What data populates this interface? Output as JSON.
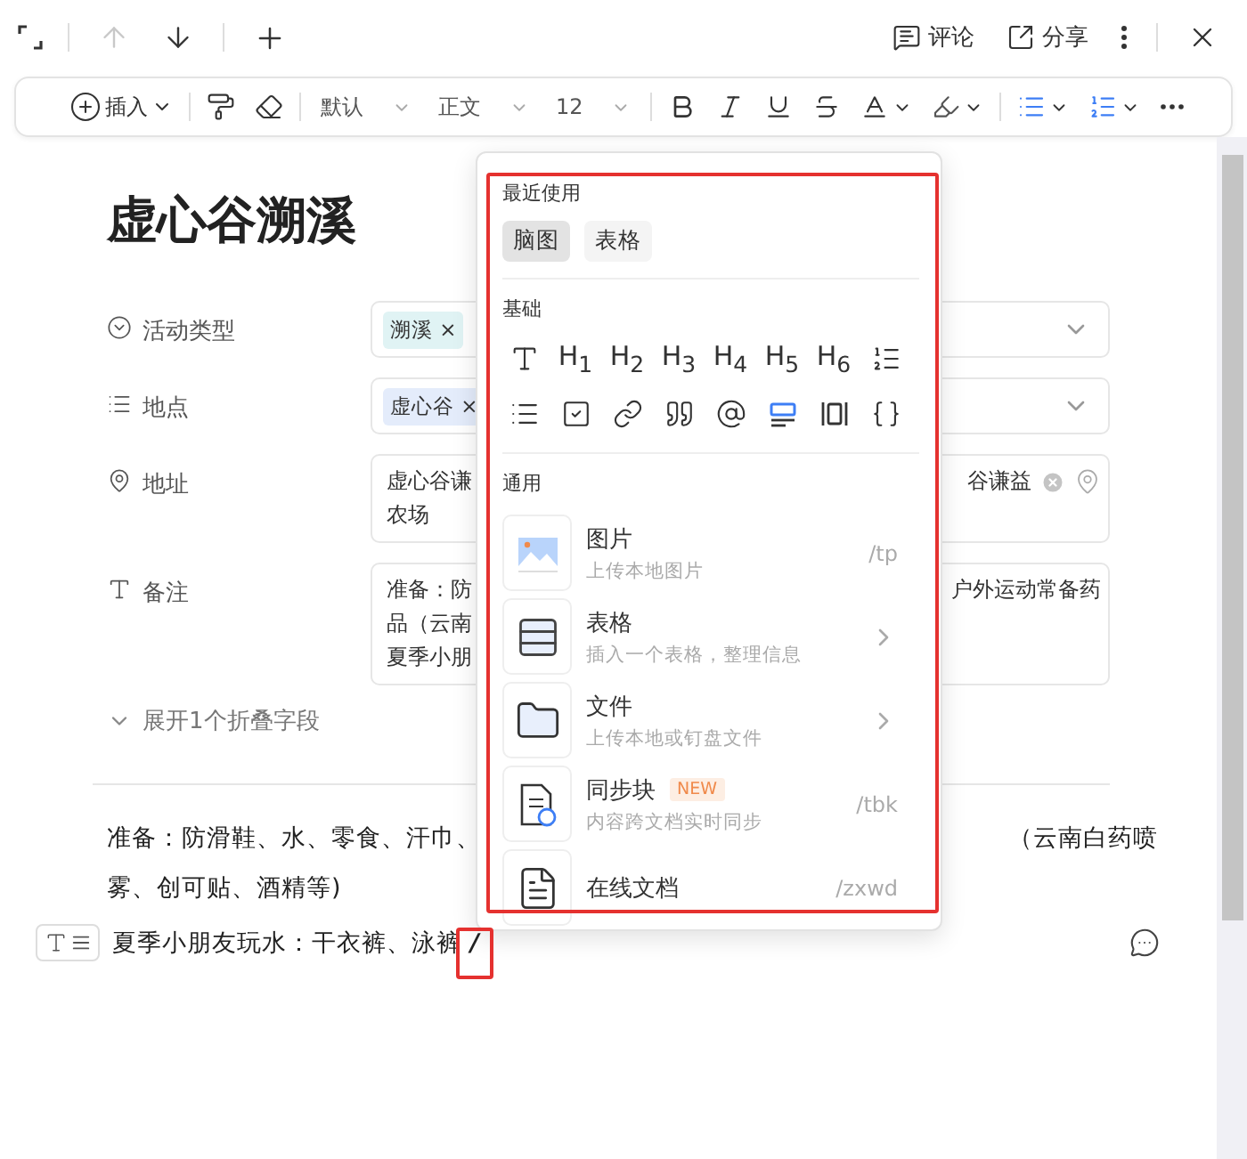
{
  "top_bar": {
    "nav": [
      {
        "kind": "up",
        "disabled": true
      },
      {
        "kind": "down",
        "disabled": false
      }
    ],
    "actions": [
      {
        "kind": "comment",
        "label": "评论"
      },
      {
        "kind": "share",
        "label": "分享"
      }
    ]
  },
  "toolbar": {
    "insert": "插入",
    "selects": [
      {
        "value": "默认"
      },
      {
        "value": "正文"
      },
      {
        "value": "12"
      }
    ]
  },
  "document": {
    "title": "虚心谷溯溪",
    "fields": [
      {
        "kind": "select",
        "label": "活动类型",
        "tags": [
          {
            "text": "溯溪",
            "remove": "×",
            "color": "#e0f3f4"
          }
        ]
      },
      {
        "kind": "select",
        "label": "地点",
        "tags": [
          {
            "text": "虚心谷",
            "remove": "×",
            "color": "#e4ecfb"
          }
        ]
      },
      {
        "kind": "address",
        "label": "地址",
        "left_lines": [
          "虚心谷谦",
          "农场"
        ],
        "right_text": "谷谦益"
      },
      {
        "kind": "note",
        "label": "备注",
        "left_lines": [
          "准备：防",
          "品（云南",
          "夏季小朋"
        ],
        "right_text": "户外运动常备药"
      }
    ],
    "expand": "展开1个折叠字段",
    "paragraph": [
      {
        "left": "准备：防滑鞋、水、零食、汗巾、",
        "right": "（云南白药喷"
      },
      {
        "left": "雾、创可贴、酒精等)"
      }
    ],
    "last_line": "夏季小朋友玩水：干衣裤、泳裤",
    "typed": "/"
  },
  "popup": {
    "sections": [
      {
        "kind": "recent",
        "title": "最近使用",
        "chips": [
          {
            "label": "脑图",
            "selected": true
          },
          {
            "label": "表格",
            "selected": false
          }
        ]
      },
      {
        "kind": "basic",
        "title": "基础",
        "items": [
          {
            "kind": "text"
          },
          {
            "kind": "heading",
            "label": "H$_{1}$"
          },
          {
            "kind": "heading",
            "label": "H$_{2}$"
          },
          {
            "kind": "heading",
            "label": "H$_{3}$"
          },
          {
            "kind": "heading",
            "label": "H$_{4}$"
          },
          {
            "kind": "heading",
            "label": "H$_{5}$"
          },
          {
            "kind": "heading",
            "label": "H$_{6}$"
          },
          {
            "kind": "ordered"
          },
          {
            "kind": "bullet"
          },
          {
            "kind": "todo"
          },
          {
            "kind": "link"
          },
          {
            "kind": "quote"
          },
          {
            "kind": "mention"
          },
          {
            "kind": "highlight"
          },
          {
            "kind": "columns"
          },
          {
            "kind": "code"
          }
        ]
      },
      {
        "kind": "general",
        "title": "通用",
        "items": [
          {
            "kind": "image",
            "title": "图片",
            "subtitle": "上传本地图片",
            "shortcut": "/tp",
            "submenu": false
          },
          {
            "kind": "table",
            "title": "表格",
            "subtitle": "插入一个表格，整理信息",
            "submenu": true
          },
          {
            "kind": "folder",
            "title": "文件",
            "subtitle": "上传本地或钉盘文件",
            "submenu": true
          },
          {
            "kind": "sync",
            "title": "同步块",
            "badge": "NEW",
            "subtitle": "内容跨文档实时同步",
            "shortcut": "/tbk",
            "submenu": false
          },
          {
            "kind": "doc",
            "title": "在线文档",
            "shortcut": "/zxwd",
            "submenu": false
          }
        ]
      }
    ]
  }
}
